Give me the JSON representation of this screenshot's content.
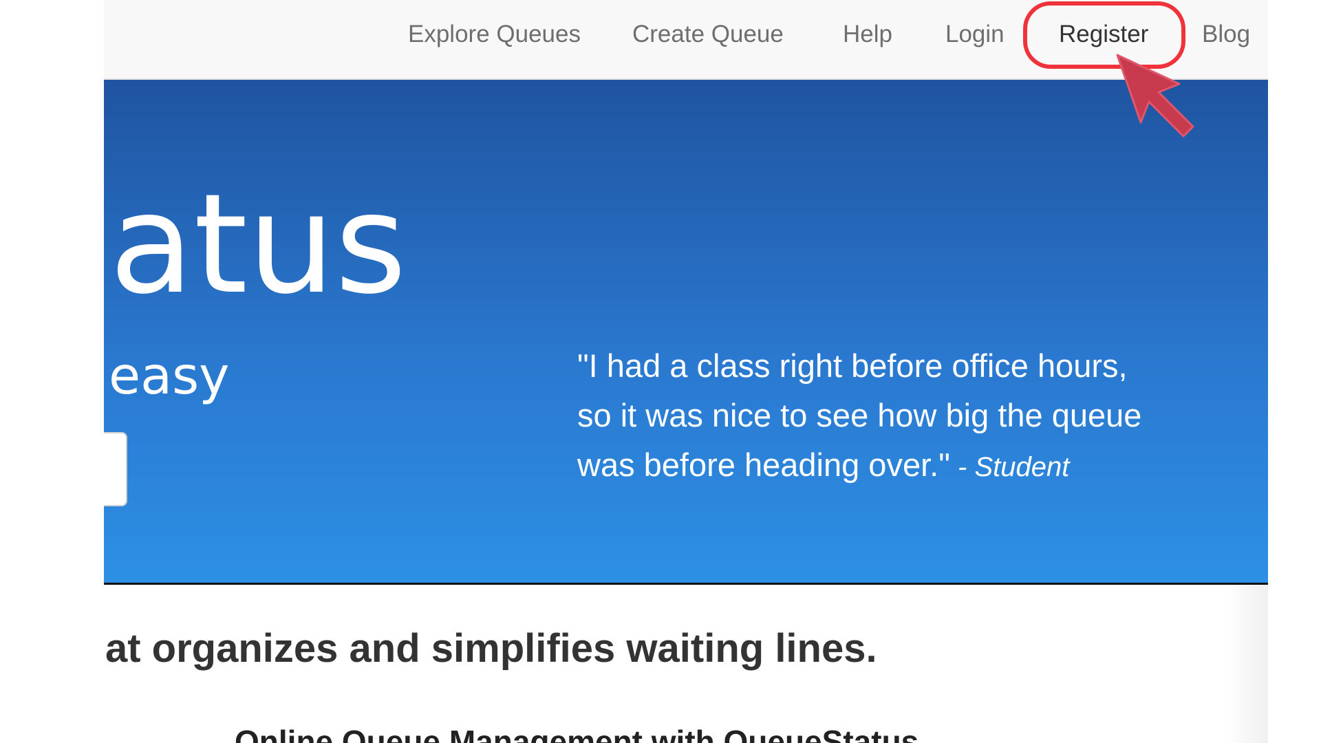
{
  "nav": {
    "items": [
      {
        "label": "Explore Queues"
      },
      {
        "label": "Create Queue"
      },
      {
        "label": "Help"
      },
      {
        "label": "Login"
      },
      {
        "label": "Register"
      },
      {
        "label": "Blog"
      }
    ],
    "highlighted_item": "Register"
  },
  "hero": {
    "title": "atus",
    "subtitle": "easy",
    "quote": {
      "line1": "\"I had a class right before office hours,",
      "line2": "so it was nice to see how big the queue",
      "line3": "was before heading over.\"",
      "author": " - Student"
    }
  },
  "tagline": "at organizes and simplifies waiting lines.",
  "section_heading": "Online Queue Management with QueueStatus",
  "annotation": {
    "highlight_color": "#f0323a",
    "cursor_icon": "pointer-arrow-icon",
    "cursor_color": "#c83a4e"
  },
  "colors": {
    "navbar_bg": "#f8f8f8",
    "hero_top": "#1f54a0",
    "hero_bottom": "#2d90e4",
    "nav_text": "#6e6e6e"
  }
}
